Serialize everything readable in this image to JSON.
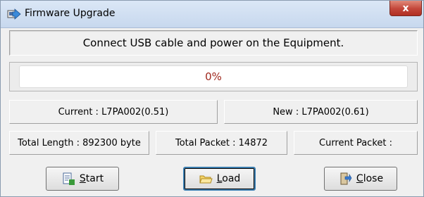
{
  "window": {
    "title": "Firmware Upgrade",
    "close_glyph": "x",
    "title_icon": "firmware-upgrade-icon"
  },
  "message": "Connect USB cable and power on the Equipment.",
  "progress": {
    "value": 0,
    "label": "0%",
    "text_color": "#a0281e"
  },
  "versions": {
    "current": "Current : L7PA002(0.51)",
    "new": "New : L7PA002(0.61)"
  },
  "stats": {
    "total_length": "Total Length : 892300 byte",
    "total_packet": "Total Packet : 14872",
    "current_packet": "Current Packet :"
  },
  "buttons": {
    "start": {
      "mnemonic": "S",
      "rest": "tart",
      "icon": "start-icon"
    },
    "load": {
      "mnemonic": "L",
      "rest": "oad",
      "icon": "folder-open-icon"
    },
    "close": {
      "mnemonic": "C",
      "rest": "lose",
      "icon": "exit-door-icon"
    }
  }
}
